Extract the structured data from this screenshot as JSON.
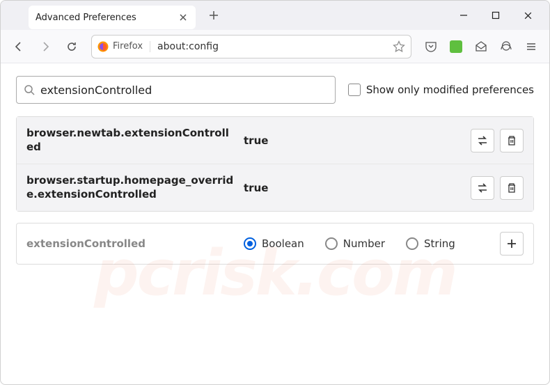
{
  "tab": {
    "title": "Advanced Preferences"
  },
  "urlbar": {
    "identity": "Firefox",
    "url": "about:config"
  },
  "search": {
    "value": "extensionControlled",
    "checkbox_label": "Show only modified preferences"
  },
  "prefs": [
    {
      "name": "browser.newtab.extensionControlled",
      "value": "true"
    },
    {
      "name": "browser.startup.homepage_override.extensionControlled",
      "value": "true"
    }
  ],
  "new_pref": {
    "name": "extensionControlled",
    "types": [
      "Boolean",
      "Number",
      "String"
    ],
    "selected": 0
  },
  "watermark": "pcrisk.com"
}
